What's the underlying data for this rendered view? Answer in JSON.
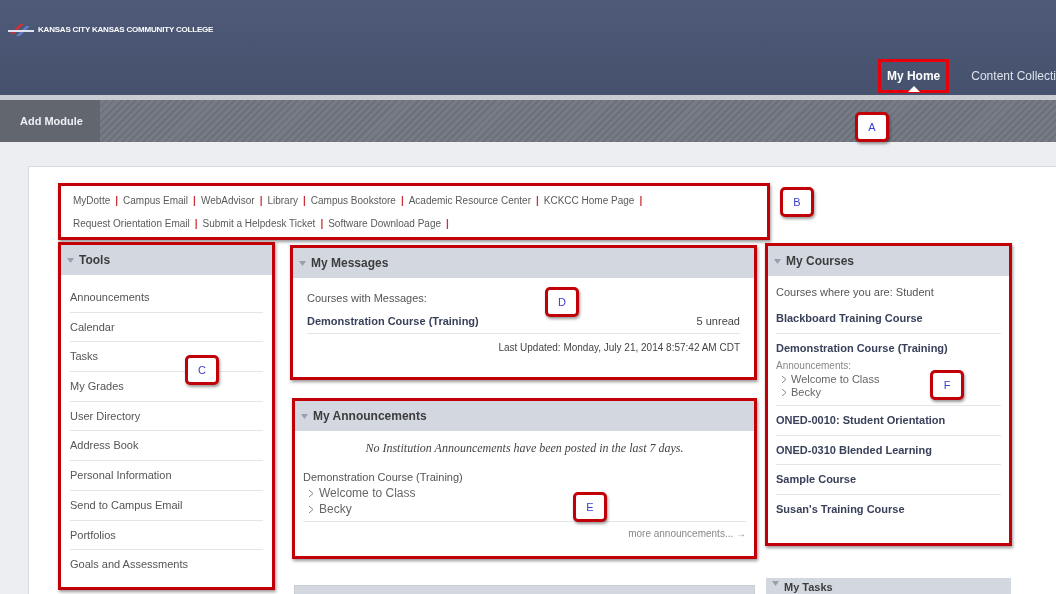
{
  "header": {
    "college_name": "KANSAS CITY KANSAS COMMUNITY COLLEGE"
  },
  "tabs": [
    {
      "label": "My Home",
      "selected": true
    },
    {
      "label": "Content Collecti",
      "selected": false
    }
  ],
  "module_bar": {
    "button": "Add Module"
  },
  "quick_links": {
    "separator": "|",
    "links": [
      "MyDotte",
      "Campus Email",
      "WebAdvisor",
      "Library",
      "Campus Bookstore",
      "Academic Resource Center",
      "KCKCC Home Page",
      "Request Orientation Email",
      "Submit a Helpdesk Ticket",
      "Software Download Page"
    ]
  },
  "tools": {
    "title": "Tools",
    "items": [
      "Announcements",
      "Calendar",
      "Tasks",
      "My Grades",
      "User Directory",
      "Address Book",
      "Personal Information",
      "Send to Campus Email",
      "Portfolios",
      "Goals and Assessments"
    ]
  },
  "messages": {
    "title": "My Messages",
    "intro": "Courses with Messages:",
    "courses": [
      {
        "name": "Demonstration Course (Training)",
        "count": "5 unread"
      }
    ],
    "last_updated": "Last Updated: Monday, July 21, 2014 8:57:42 AM CDT"
  },
  "announcements": {
    "title": "My Announcements",
    "notice": "No Institution Announcements have been posted in the last 7 days.",
    "course": "Demonstration Course (Training)",
    "items": [
      "Welcome to Class",
      "Becky"
    ],
    "more": "more announcements... →"
  },
  "courses": {
    "title": "My Courses",
    "intro": "Courses where you are: Student",
    "list": [
      {
        "name": "Blackboard Training Course"
      },
      {
        "name": "Demonstration Course (Training)",
        "announcements_label": "Announcements:",
        "announcements": [
          "Welcome to Class",
          "Becky"
        ]
      },
      {
        "name": "ONED-0010: Student Orientation"
      },
      {
        "name": "ONED-0310 Blended Learning"
      },
      {
        "name": "Sample Course"
      },
      {
        "name": "Susan's Training Course"
      }
    ]
  },
  "tasks": {
    "title": "My Tasks"
  },
  "callouts": [
    "A",
    "B",
    "C",
    "D",
    "E",
    "F"
  ]
}
